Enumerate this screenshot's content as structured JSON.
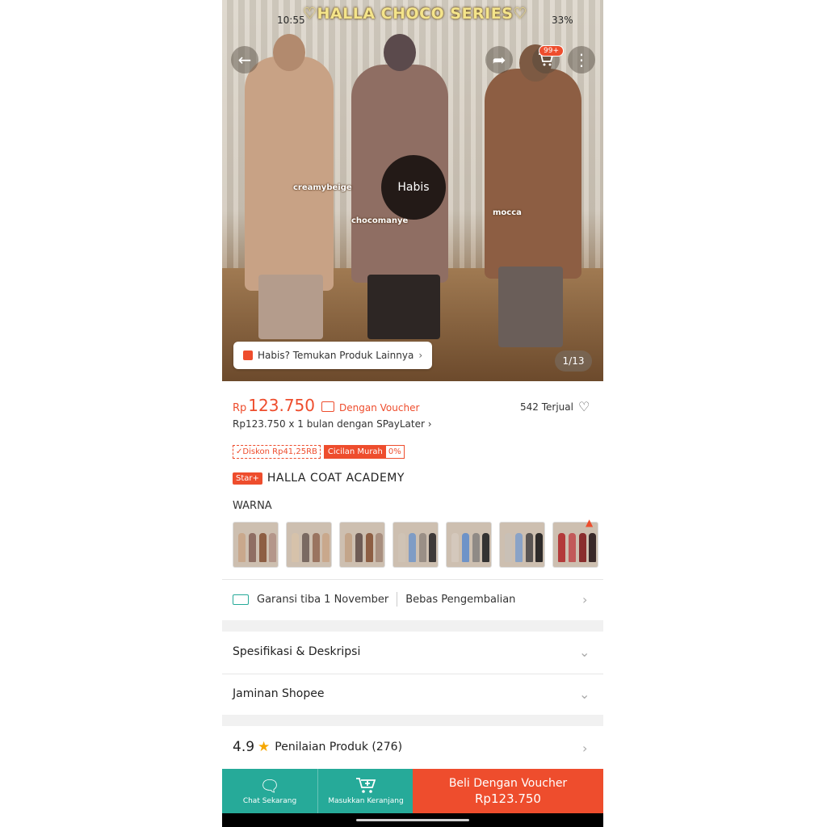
{
  "status_bar": {
    "time": "10:55",
    "battery": "33%"
  },
  "hero": {
    "series_title": "♡HALLA CHOCO SERIES♡",
    "cart_badge": "99+",
    "tags": [
      "creamybeige",
      "chocomanye",
      "mocca"
    ],
    "sold_out_label": "Habis",
    "find_other_label": "Habis? Temukan Produk Lainnya",
    "image_counter": "1/13",
    "icons": {
      "back": "arrow-left-icon",
      "share": "share-icon",
      "cart": "cart-icon",
      "more": "more-vertical-icon"
    }
  },
  "product": {
    "currency": "Rp",
    "price": "123.750",
    "voucher_label": "Dengan Voucher",
    "sold": "542 Terjual",
    "paylater": "Rp123.750 x 1 bulan dengan SPayLater",
    "discount_chip": "Diskon Rp41,25RB",
    "installment_chip_label": "Cicilan Murah",
    "installment_chip_value": "0%",
    "shop_badge": "Star+",
    "shop_name": "HALLA COAT ACADEMY",
    "variant_heading": "WARNA"
  },
  "shipping": {
    "guarantee": "Garansi tiba 1 November",
    "returns": "Bebas Pengembalian"
  },
  "sections": {
    "spec": "Spesifikasi & Deskripsi",
    "guarantee": "Jaminan Shopee"
  },
  "rating": {
    "score": "4.9",
    "label": "Penilaian Produk (276)"
  },
  "bottom_bar": {
    "chat": "Chat Sekarang",
    "cart": "Masukkan Keranjang",
    "buy_label": "Beli Dengan Voucher",
    "buy_price": "Rp123.750"
  },
  "colors": {
    "accent": "#ee4d2d",
    "teal": "#26aa99",
    "star": "#f6a700"
  }
}
